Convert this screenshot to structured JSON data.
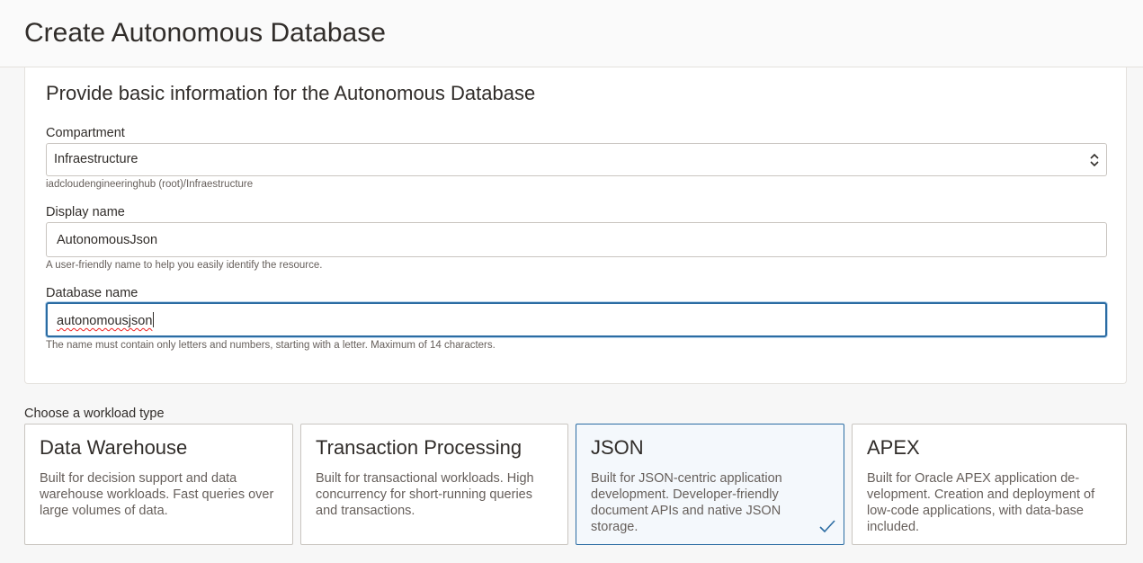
{
  "header": {
    "title": "Create Autonomous Database"
  },
  "basic_info": {
    "title": "Provide basic information for the Autonomous Database",
    "compartment": {
      "label": "Compartment",
      "value": "Infraestructure",
      "helper": "iadcloudengineeringhub (root)/Infraestructure"
    },
    "display_name": {
      "label": "Display name",
      "value": "AutonomousJson",
      "helper": "A user-friendly name to help you easily identify the resource."
    },
    "database_name": {
      "label": "Database name",
      "value": "autonomousjson",
      "helper": "The name must contain only letters and numbers, starting with a letter. Maximum of 14 characters."
    }
  },
  "workload": {
    "label": "Choose a workload type",
    "selected": "JSON",
    "options": [
      {
        "title": "Data Warehouse",
        "description": "Built for decision support and data warehouse workloads. Fast queries over large volumes of data."
      },
      {
        "title": "Transaction Processing",
        "description": "Built for transactional workloads. High concurrency for short-running queries and transactions."
      },
      {
        "title": "JSON",
        "description": "Built for JSON-centric application development. Developer-friendly document APIs and native JSON storage."
      },
      {
        "title": "APEX",
        "description": "Built for Oracle APEX application de-velopment. Creation and deployment of low-code applications, with data-base included."
      }
    ]
  },
  "icons": {
    "select": "chevron-up-down-icon",
    "selected_card": "checkmark-icon"
  },
  "colors": {
    "accent": "#2b6ca3",
    "selected_bg": "#f4f8fc"
  }
}
